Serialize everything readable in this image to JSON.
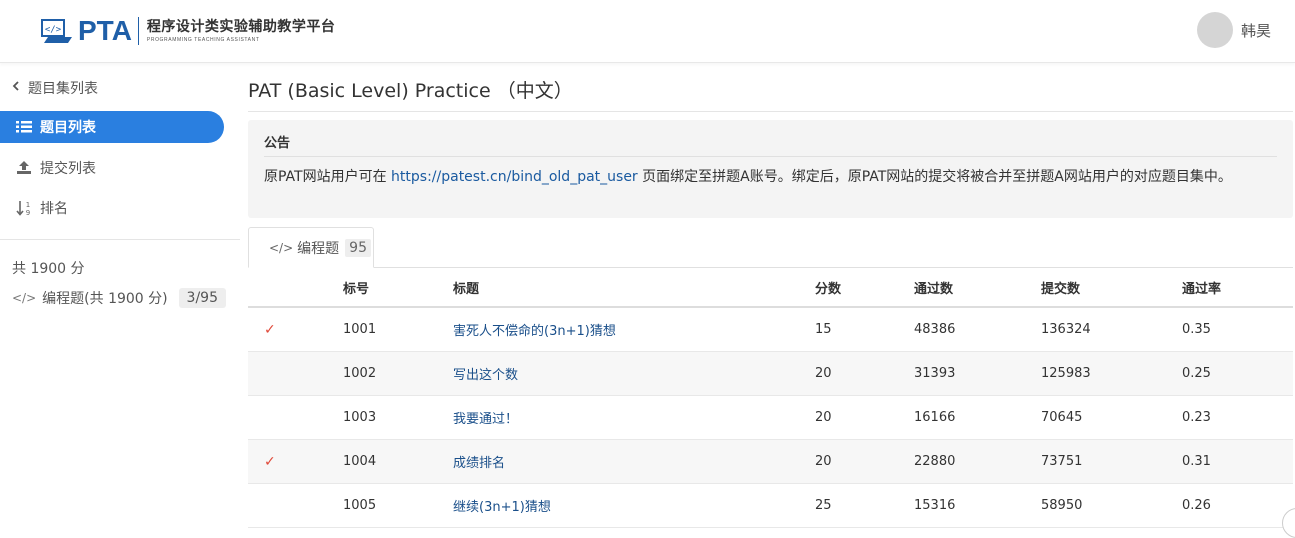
{
  "header": {
    "logo_mark": "PTA",
    "logo_cn": "程序设计类实验辅助教学平台",
    "logo_en": "PROGRAMMING TEACHING ASSISTANT",
    "user_name": "韩昊"
  },
  "sidebar": {
    "back_label": "题目集列表",
    "items": [
      {
        "label": "题目列表",
        "icon": "list-icon",
        "active": true
      },
      {
        "label": "提交列表",
        "icon": "upload-icon",
        "active": false
      },
      {
        "label": "排名",
        "icon": "sort-icon",
        "active": false
      }
    ],
    "total": "共 1900 分",
    "set_code": "</>",
    "set_label": "编程题(共 1900 分)",
    "set_count": "3/95"
  },
  "main": {
    "title": "PAT (Basic Level) Practice （中文）",
    "notice": {
      "title": "公告",
      "text_before": "原PAT网站用户可在 ",
      "link": "https://patest.cn/bind_old_pat_user",
      "text_after": " 页面绑定至拼题A账号。绑定后，原PAT网站的提交将被合并至拼题A网站用户的对应题目集中。"
    },
    "tab": {
      "code": "</>",
      "label": "编程题",
      "count": "95"
    },
    "columns": [
      "",
      "标号",
      "标题",
      "分数",
      "通过数",
      "提交数",
      "通过率"
    ],
    "rows": [
      {
        "solved": true,
        "num": "1001",
        "title": "害死人不偿命的(3n+1)猜想",
        "score": "15",
        "pass": "48386",
        "submit": "136324",
        "rate": "0.35"
      },
      {
        "solved": false,
        "num": "1002",
        "title": "写出这个数",
        "score": "20",
        "pass": "31393",
        "submit": "125983",
        "rate": "0.25"
      },
      {
        "solved": false,
        "num": "1003",
        "title": "我要通过！",
        "score": "20",
        "pass": "16166",
        "submit": "70645",
        "rate": "0.23"
      },
      {
        "solved": true,
        "num": "1004",
        "title": "成绩排名",
        "score": "20",
        "pass": "22880",
        "submit": "73751",
        "rate": "0.31"
      },
      {
        "solved": false,
        "num": "1005",
        "title": "继续(3n+1)猜想",
        "score": "25",
        "pass": "15316",
        "submit": "58950",
        "rate": "0.26"
      }
    ],
    "check_glyph": "✓"
  },
  "colors": {
    "accent": "#2a7fe0",
    "brand": "#1f5fa8",
    "link": "#1a4f8a",
    "check": "#e04a3a"
  }
}
